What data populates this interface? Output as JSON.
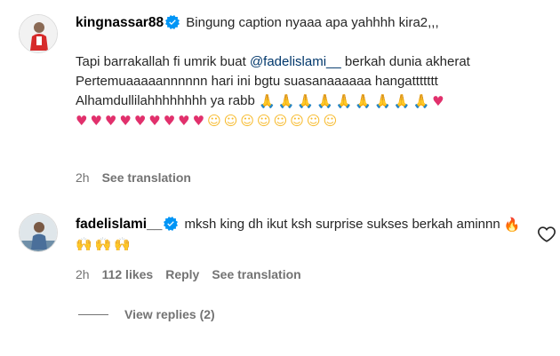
{
  "comments": [
    {
      "username": "kingnassar88",
      "line1": "Bingung caption nyaaa apa yahhhh kira2,,,",
      "line2_prefix": "Tapi barrakallah fi umrik buat",
      "mention": "@fadelislami__",
      "line2_suffix": "berkah dunia akherat",
      "line3": "Pertemuaaaaannnnnn hari ini bgtu suasanaaaaaa hangattttttt",
      "line4": "Alhamdullilahhhhhhhh ya rabb",
      "time": "2h",
      "see_translation": "See translation"
    },
    {
      "username": "fadelislami__",
      "text": "mksh king dh ikut ksh surprise sukses berkah aminnn",
      "time": "2h",
      "likes": "112 likes",
      "reply": "Reply",
      "see_translation": "See translation"
    }
  ],
  "replies": {
    "label": "View replies (2)"
  },
  "colors": {
    "verified": "#0095f6",
    "mention": "#00376b",
    "meta": "#737373"
  },
  "icons": [
    "verified-badge-icon",
    "heart-outline-icon",
    "pray-emoji",
    "heart-emoji",
    "kiss-emoji",
    "fire-emoji",
    "raised-hands-emoji"
  ]
}
